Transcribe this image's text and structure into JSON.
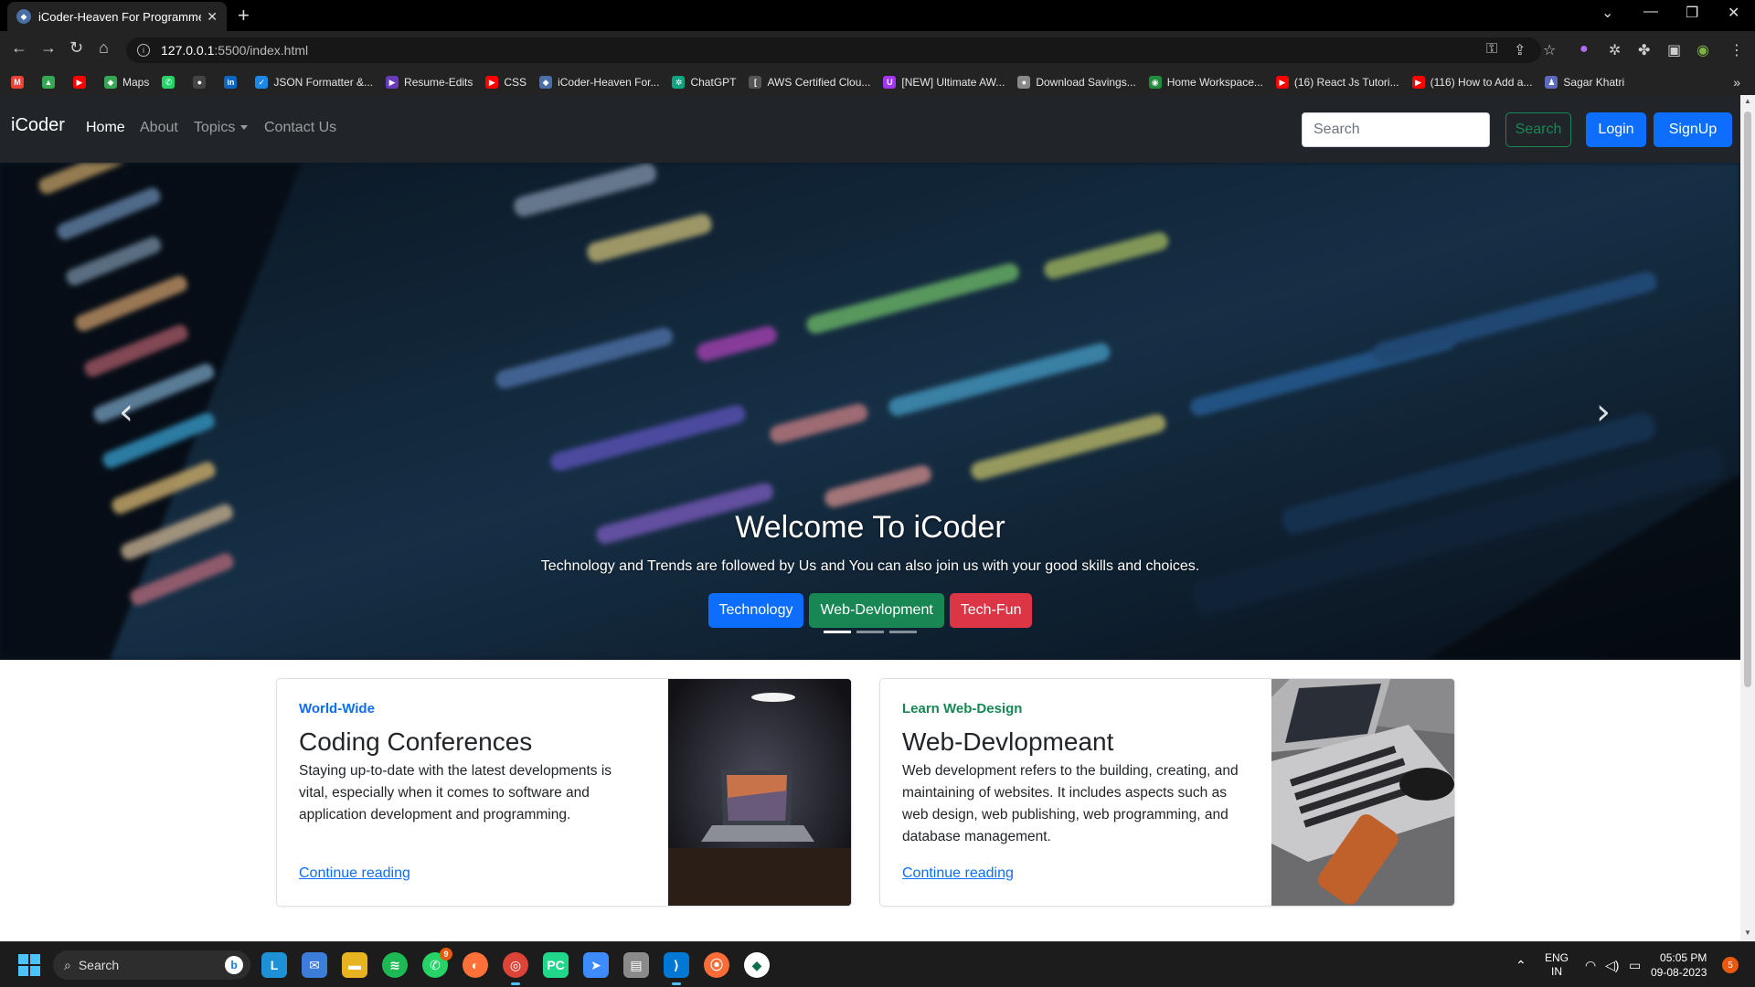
{
  "browser": {
    "tab_title": "iCoder-Heaven For Programmers",
    "url_host": "127.0.0.1",
    "url_rest": ":5500/index.html",
    "bookmarks": [
      {
        "label": "",
        "icon": "gmail-icon",
        "color": "#ea4335"
      },
      {
        "label": "",
        "icon": "drive-icon",
        "color": "#34a853"
      },
      {
        "label": "",
        "icon": "youtube-icon",
        "color": "#ff0000"
      },
      {
        "label": "Maps",
        "icon": "maps-icon",
        "color": "#34a853"
      },
      {
        "label": "",
        "icon": "whatsapp-icon",
        "color": "#25d366"
      },
      {
        "label": "",
        "icon": "github-icon",
        "color": "#444444"
      },
      {
        "label": "",
        "icon": "linkedin-icon",
        "color": "#0a66c2"
      },
      {
        "label": "JSON Formatter &...",
        "icon": "check-icon",
        "color": "#1e88e5"
      },
      {
        "label": "Resume-Edits",
        "icon": "play-icon",
        "color": "#673ab7"
      },
      {
        "label": "CSS",
        "icon": "youtube-icon",
        "color": "#ff0000"
      },
      {
        "label": "iCoder-Heaven For...",
        "icon": "vscode-icon",
        "color": "#4a6fa5"
      },
      {
        "label": "ChatGPT",
        "icon": "chatgpt-icon",
        "color": "#10a37f"
      },
      {
        "label": "AWS Certified Clou...",
        "icon": "bracket-icon",
        "color": "#555555"
      },
      {
        "label": "[NEW] Ultimate AW...",
        "icon": "udemy-icon",
        "color": "#a435f0"
      },
      {
        "label": "Download Savings...",
        "icon": "globe-icon",
        "color": "#888888"
      },
      {
        "label": "Home Workspace...",
        "icon": "postman-icon",
        "color": "#1e8e3e"
      },
      {
        "label": "(16) React Js Tutori...",
        "icon": "youtube-icon",
        "color": "#ff0000"
      },
      {
        "label": "(116) How to Add a...",
        "icon": "youtube-icon",
        "color": "#ff0000"
      },
      {
        "label": "Sagar Khatri",
        "icon": "person-icon",
        "color": "#5c6bc0"
      }
    ]
  },
  "navbar": {
    "brand": "iCoder",
    "links": {
      "home": "Home",
      "about": "About",
      "topics": "Topics",
      "contact": "Contact Us"
    },
    "search_placeholder": "Search",
    "search_button": "Search",
    "login": "Login",
    "signup": "SignUp"
  },
  "carousel": {
    "heading": "Welcome To iCoder",
    "text": "Technology and Trends are followed by Us and You can also join us with your good skills and choices.",
    "buttons": {
      "tech": "Technology",
      "web": "Web-Devlopment",
      "fun": "Tech-Fun"
    },
    "slides": 3,
    "active_slide": 1
  },
  "cards": [
    {
      "kicker": "World-Wide",
      "kicker_color": "#0d6efd",
      "title": "Coding Conferences",
      "text": "Staying up-to-date with the latest developments is vital, especially when it comes to software and application development and programming.",
      "link": "Continue reading"
    },
    {
      "kicker": "Learn Web-Design",
      "kicker_color": "#198754",
      "title": "Web-Devlopmeant",
      "text": "Web development refers to the building, creating, and maintaining of websites. It includes aspects such as web design, web publishing, web programming, and database management.",
      "link": "Continue reading"
    }
  ],
  "taskbar": {
    "search": "Search",
    "whatsapp_badge": "9",
    "lang": "ENG",
    "region": "IN",
    "time": "05:05 PM",
    "date": "09-08-2023",
    "notifications": "5"
  }
}
